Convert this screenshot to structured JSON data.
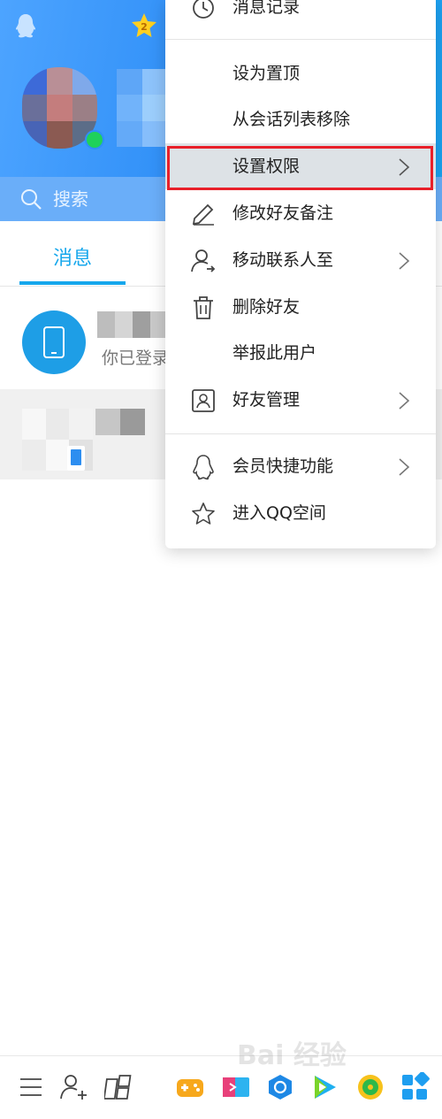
{
  "header": {
    "search_placeholder": "搜索",
    "vip_badge": "2"
  },
  "tabs": {
    "messages_label": "消息"
  },
  "conversations": [
    {
      "subtitle": "你已登录"
    }
  ],
  "context_menu": {
    "items": [
      {
        "label": "消息记录",
        "icon": "clock-icon",
        "has_arrow": false
      },
      {
        "label": "设为置顶",
        "icon": "",
        "has_arrow": false
      },
      {
        "label": "从会话列表移除",
        "icon": "",
        "has_arrow": false
      },
      {
        "label": "设置权限",
        "icon": "",
        "has_arrow": true,
        "highlighted": true
      },
      {
        "label": "修改好友备注",
        "icon": "pencil-icon",
        "has_arrow": false
      },
      {
        "label": "移动联系人至",
        "icon": "move-contact-icon",
        "has_arrow": true
      },
      {
        "label": "删除好友",
        "icon": "trash-icon",
        "has_arrow": false
      },
      {
        "label": "举报此用户",
        "icon": "",
        "has_arrow": false
      },
      {
        "label": "好友管理",
        "icon": "contact-card-icon",
        "has_arrow": true
      },
      {
        "label": "会员快捷功能",
        "icon": "penguin-icon",
        "has_arrow": true
      },
      {
        "label": "进入QQ空间",
        "icon": "star-icon",
        "has_arrow": false
      }
    ]
  },
  "watermark": {
    "text": "Bai 经验"
  },
  "colors": {
    "accent": "#16a7ec",
    "highlight_border": "#e8202a",
    "online": "#1fd15a"
  }
}
